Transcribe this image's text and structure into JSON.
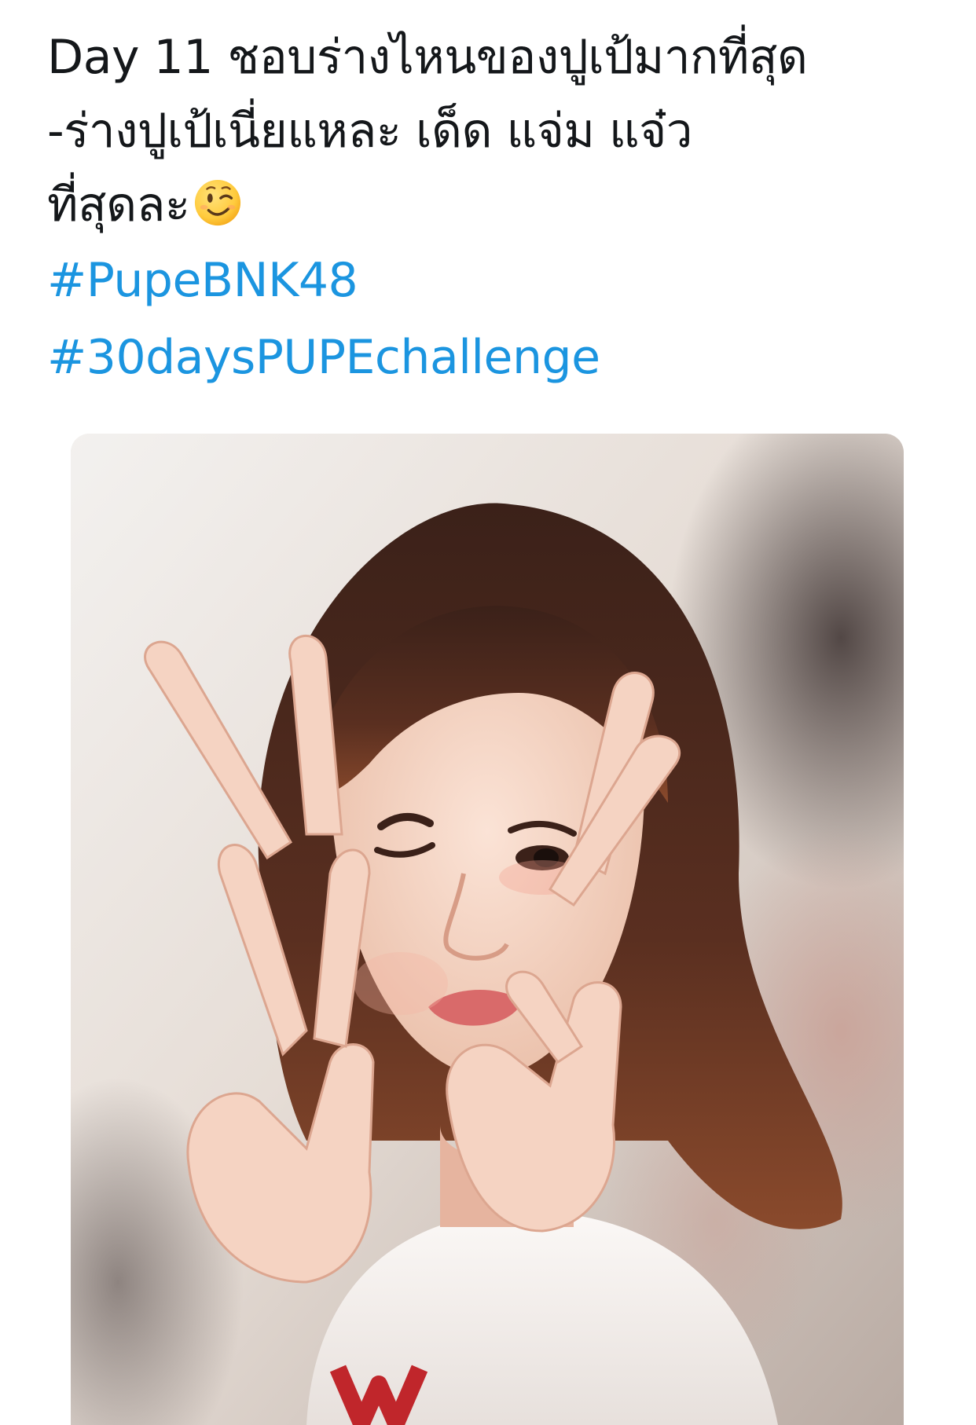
{
  "tweet": {
    "lines": [
      "Day 11 ชอบร่างไหนของปูเป้มากที่สุด",
      "-ร่างปูเป้เนี่ยแหละ เด็ด แจ่ม แจ๋ว",
      "ที่สุดละ"
    ],
    "emoji": "winking-face",
    "hashtags": [
      "#PupeBNK48",
      "#30daysPUPEchallenge"
    ]
  },
  "colors": {
    "text": "#14171a",
    "link": "#1b95e0",
    "background": "#ffffff"
  },
  "media": {
    "kind": "photo"
  }
}
